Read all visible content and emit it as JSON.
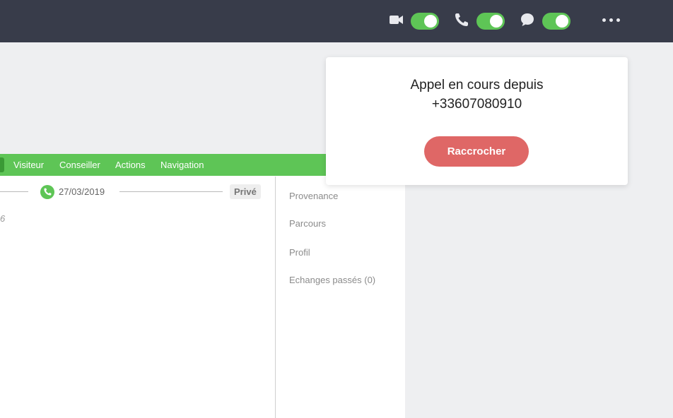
{
  "topbar": {
    "icons": [
      "video-camera-icon",
      "phone-icon",
      "chat-bubble-icon",
      "more-dots-icon"
    ],
    "toggles": [
      {
        "name": "video",
        "on": true
      },
      {
        "name": "phone",
        "on": true
      },
      {
        "name": "chat",
        "on": true
      }
    ]
  },
  "nav": {
    "items": [
      "Visiteur",
      "Conseiller",
      "Actions",
      "Navigation"
    ]
  },
  "timeline": {
    "date": "27/03/2019",
    "badge": "Privé",
    "fragment": "6"
  },
  "sidebar": {
    "items": [
      "Provenance",
      "Parcours",
      "Profil",
      "Echanges passés (0)"
    ]
  },
  "popup": {
    "line1": "Appel en cours depuis",
    "line2": "+33607080910",
    "button": "Raccrocher"
  },
  "colors": {
    "topbar": "#383c4a",
    "accent_green": "#5ec556",
    "hangup_red": "#df6766"
  }
}
